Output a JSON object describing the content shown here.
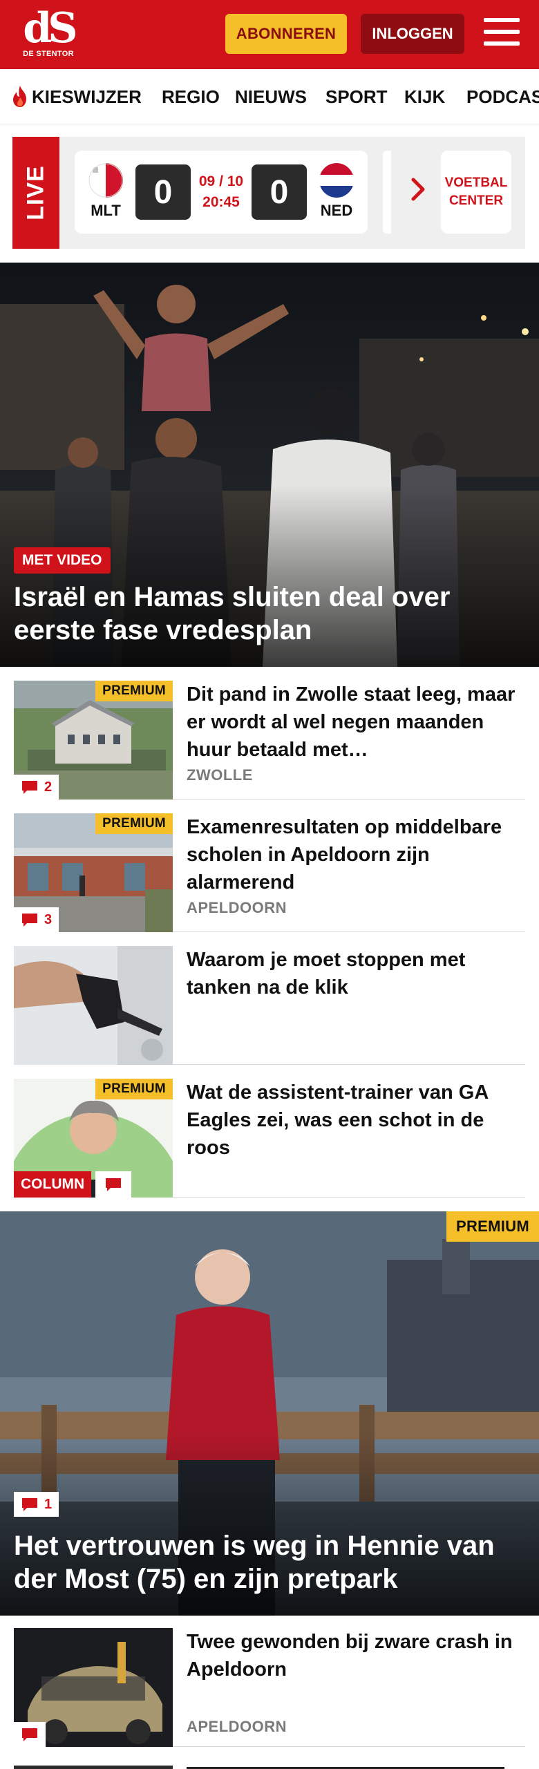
{
  "header": {
    "logo_mark": "dS",
    "logo_text": "DE STENTOR",
    "subscribe_label": "ABONNEREN",
    "login_label": "INLOGGEN",
    "brand_red": "#d0131a",
    "accent_yellow": "#f5bf2a"
  },
  "nav": {
    "items": [
      {
        "label": "KIESWIJZER",
        "icon": "flame-icon"
      },
      {
        "label": "REGIO"
      },
      {
        "label": "NIEUWS"
      },
      {
        "label": "SPORT"
      },
      {
        "label": "KIJK"
      },
      {
        "label": "PODCAS"
      }
    ]
  },
  "live": {
    "label": "LIVE",
    "home_code": "MLT",
    "home_score": "0",
    "away_code": "NED",
    "away_score": "0",
    "date": "09 / 10",
    "time": "20:45",
    "voetbal_center": "VOETBAL CENTER"
  },
  "hero": {
    "badge": "MET VIDEO",
    "title": "Israël en Hamas sluiten deal over eerste fase vredesplan"
  },
  "articles": [
    {
      "premium": "PREMIUM",
      "comments": "2",
      "title": "Dit pand in Zwolle staat leeg, maar er wordt al wel negen maanden huur betaald met…",
      "location": "ZWOLLE"
    },
    {
      "premium": "PREMIUM",
      "comments": "3",
      "title": "Examenresultaten op middelbare scholen in Apeldoorn zijn alarmerend",
      "location": "APELDOORN"
    },
    {
      "title": "Waarom je moet stoppen met tanken na de klik"
    },
    {
      "premium": "PREMIUM",
      "column": "COLUMN",
      "title": "Wat de assistent-trainer van GA Eagles zei, was een schot in de roos"
    }
  ],
  "feature": {
    "premium": "PREMIUM",
    "comments": "1",
    "title": "Het vertrouwen is weg in Hennie van der Most (75) en zijn pretpark"
  },
  "article_after": {
    "title": "Twee gewonden bij zware crash in Apeldoorn",
    "location": "APELDOORN"
  }
}
